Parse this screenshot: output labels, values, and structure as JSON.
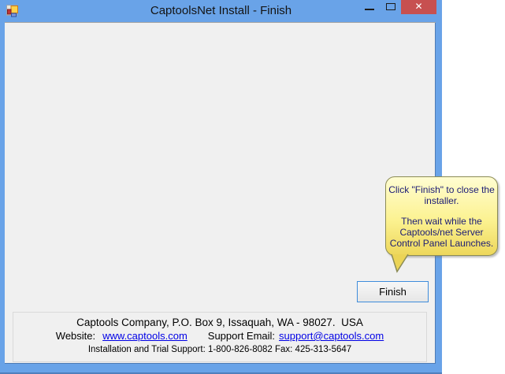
{
  "window": {
    "title": "CaptoolsNet Install - Finish",
    "close_glyph": "✕"
  },
  "balloon": {
    "lines": [
      "Click \"Finish\" to close the",
      "installer.",
      "Then wait while the",
      "Captools/net Server",
      "Control Panel Launches."
    ]
  },
  "finish_button": {
    "label": "Finish"
  },
  "footer": {
    "line1": "Captools Company, P.O. Box 9, Issaquah, WA - 98027.  USA",
    "website_label": "Website:",
    "website_link": "www.captools.com",
    "support_label": "Support Email:",
    "support_link": "support@captools.com",
    "line3": "Installation and Trial Support: 1-800-826-8082 Fax: 425-313-5647"
  },
  "colors": {
    "titlebar_blue": "#69A3E8",
    "close_button_red": "#C75050",
    "client_gray": "#F0F0F0",
    "balloon_top": "#FFFDD2",
    "balloon_bottom": "#EDD75B",
    "balloon_border": "#8B8B55",
    "balloon_text": "#1B1B75",
    "link_blue": "#0000E6",
    "focused_button_border": "#3E8CDB"
  }
}
